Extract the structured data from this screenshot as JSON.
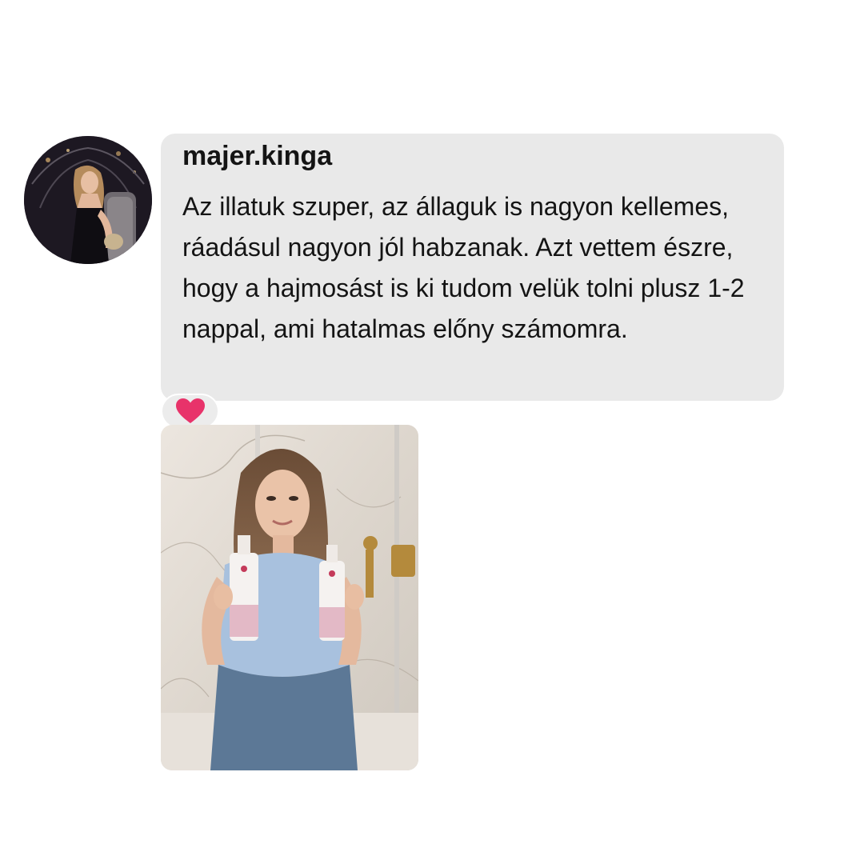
{
  "comment": {
    "username": "majer.kinga",
    "message": "Az illatuk szuper, az állaguk is nagyon kellemes, ráadásul nagyon jól habzanak. Azt vettem észre, hogy a hajmosást is ki tudom velük tolni plusz 1-2 nappal, ami hatalmas előny számomra."
  },
  "reaction": {
    "icon": "heart-icon",
    "color": "#e8336a"
  },
  "colors": {
    "bubble": "#e9e9e9",
    "text": "#141414",
    "background": "#ffffff"
  }
}
